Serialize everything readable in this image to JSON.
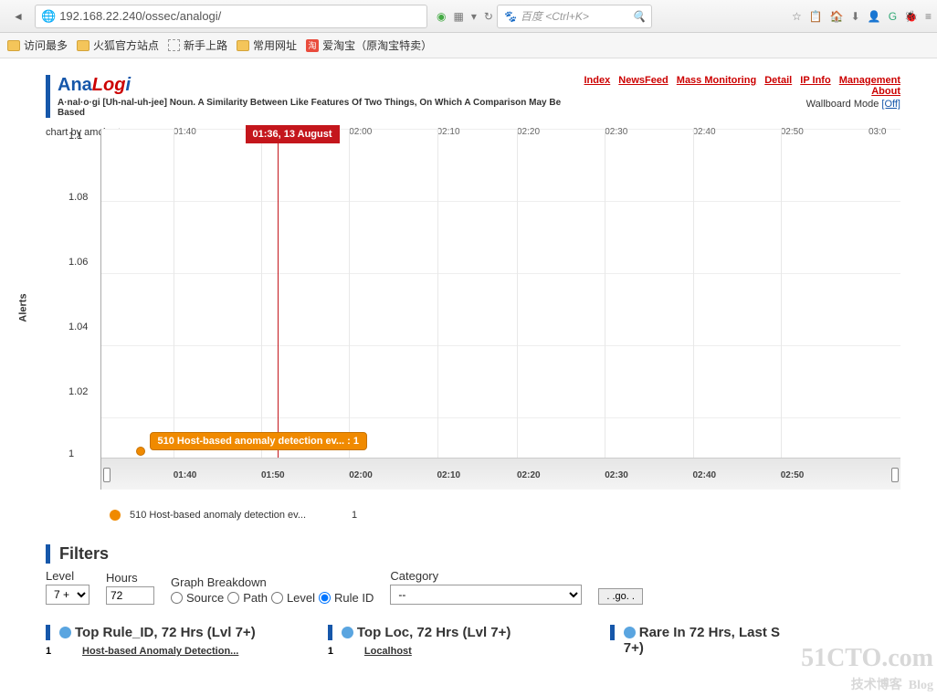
{
  "browser": {
    "url": "192.168.22.240/ossec/analogi/",
    "search_placeholder": "百度 <Ctrl+K>"
  },
  "bookmarks": [
    "访问最多",
    "火狐官方站点",
    "新手上路",
    "常用网址",
    "爱淘宝（原淘宝特卖）"
  ],
  "app": {
    "title_parts": {
      "ana": "Ana",
      "log": "Log",
      "i": "i"
    },
    "subtitle": "A·nal·o·gi [Uh-nal-uh-jee] Noun. A Similarity Between Like Features Of Two Things, On Which A Comparison May Be Based",
    "nav": [
      "Index",
      "NewsFeed",
      "Mass Monitoring",
      "Detail",
      "IP Info",
      "Management",
      "About"
    ],
    "wallboard_label": "Wallboard Mode ",
    "wallboard_state": "[Off]"
  },
  "chart_credit": "chart by amcharts.com",
  "chart_data": {
    "type": "line",
    "ylabel": "Alerts",
    "ylim": [
      1.0,
      1.1
    ],
    "y_ticks": [
      "1",
      "1.02",
      "1.04",
      "1.06",
      "1.08",
      "1.1"
    ],
    "x_top_ticks": [
      "01:40",
      "02:00",
      "02:10",
      "02:20",
      "02:30",
      "02:40",
      "02:50",
      "03:0"
    ],
    "x_bot_ticks": [
      "01:40",
      "01:50",
      "02:00",
      "02:10",
      "02:20",
      "02:30",
      "02:40",
      "02:50"
    ],
    "cursor_time": "01:36, 13 August",
    "tooltip": "510 Host-based anomaly detection ev... : 1",
    "series": [
      {
        "name": "510 Host-based anomaly detection ev...",
        "x": [
          "01:36"
        ],
        "values": [
          1
        ]
      }
    ],
    "legend": {
      "label": "510 Host-based anomaly detection ev...",
      "value": "1"
    }
  },
  "filters": {
    "heading": "Filters",
    "level_label": "Level",
    "level_value": "7 +",
    "hours_label": "Hours",
    "hours_value": "72",
    "breakdown_label": "Graph Breakdown",
    "breakdown_options": [
      "Source",
      "Path",
      "Level",
      "Rule ID"
    ],
    "breakdown_selected": "Rule ID",
    "category_label": "Category",
    "category_value": "--",
    "go_label": ". .go. ."
  },
  "panels": {
    "p1": {
      "title": "Top Rule_ID, 72 Hrs (Lvl 7+)",
      "count": "1",
      "link": "Host-based Anomaly Detection..."
    },
    "p2": {
      "title": "Top Loc, 72 Hrs (Lvl 7+)",
      "count": "1",
      "link": "Localhost"
    },
    "p3": {
      "title": "Rare In 72 Hrs, Last S",
      "extra": "7+)"
    }
  },
  "watermark": {
    "main": "51CTO.com",
    "sub1": "技术博客",
    "sub2": "Blog"
  }
}
